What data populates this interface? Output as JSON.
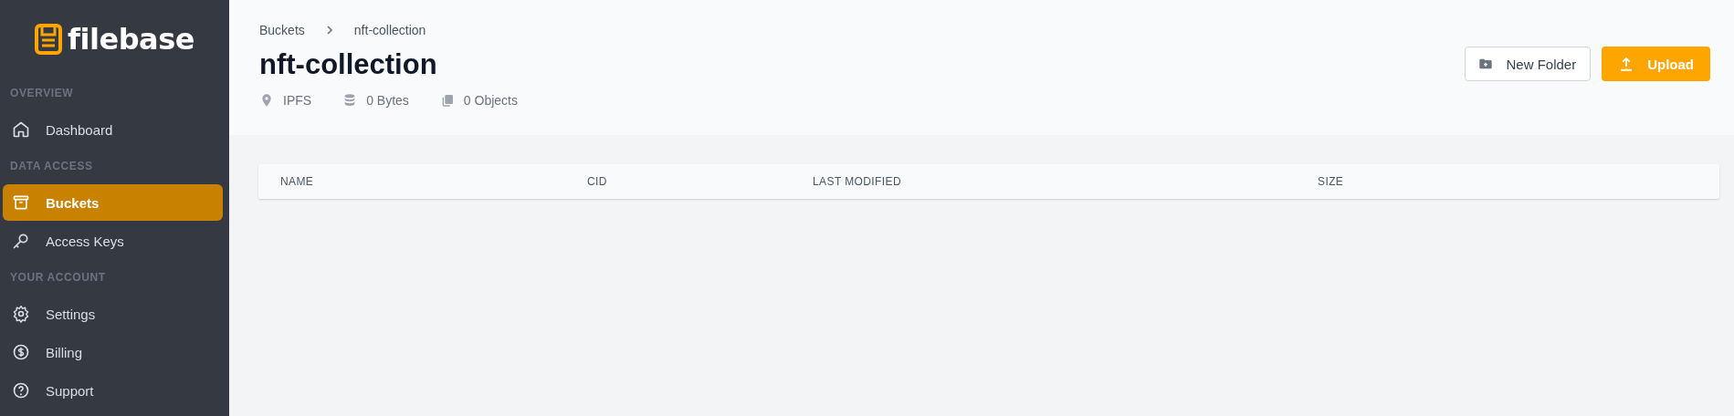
{
  "sidebar": {
    "logo": "filebase",
    "sections": [
      {
        "heading": "OVERVIEW",
        "items": [
          {
            "label": "Dashboard",
            "selected": false
          }
        ]
      },
      {
        "heading": "DATA ACCESS",
        "items": [
          {
            "label": "Buckets",
            "selected": true
          },
          {
            "label": "Access Keys",
            "selected": false
          }
        ]
      },
      {
        "heading": "YOUR ACCOUNT",
        "items": [
          {
            "label": "Settings",
            "selected": false
          },
          {
            "label": "Billing",
            "selected": false
          },
          {
            "label": "Support",
            "selected": false
          }
        ]
      }
    ]
  },
  "breadcrumb": [
    "Buckets",
    "nft-collection"
  ],
  "title": "nft-collection",
  "meta": [
    "IPFS",
    "0 Bytes",
    "0 Objects"
  ],
  "buttons": [
    {
      "kind": "secondary",
      "label": "New Folder"
    },
    {
      "kind": "primary",
      "label": "Upload"
    }
  ],
  "table": {
    "columns": [
      "NAME",
      "CID",
      "LAST MODIFIED",
      "SIZE"
    ]
  }
}
